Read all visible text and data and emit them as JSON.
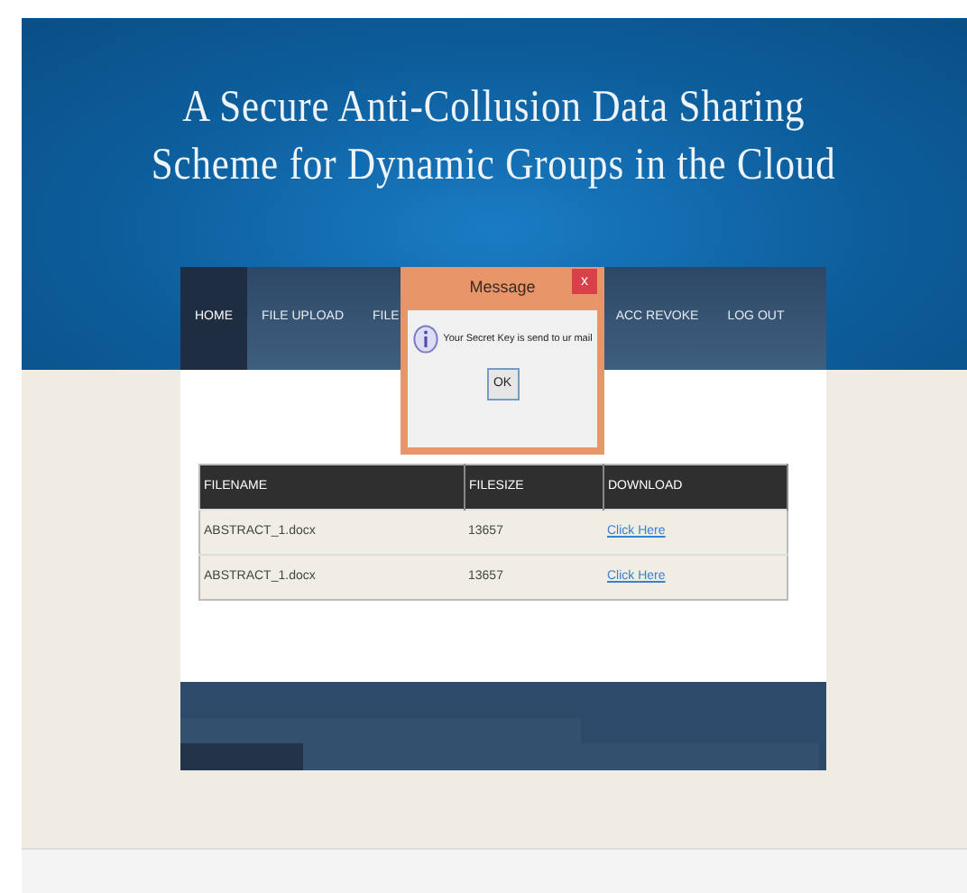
{
  "header": {
    "title_lines": [
      "A Secure Anti-Collusion Data Sharing",
      "Scheme for Dynamic Groups in the Cloud"
    ]
  },
  "nav": [
    {
      "label": "HOME",
      "selected": true
    },
    {
      "label": "FILE UPLOAD",
      "selected": false
    },
    {
      "label": "FILE",
      "selected": false
    },
    {
      "label": "ACC REVOKE",
      "selected": false
    },
    {
      "label": "LOG OUT",
      "selected": false
    }
  ],
  "dialog": {
    "title": "Message",
    "close": "x",
    "message": "Your Secret Key is send to ur mail",
    "button": "OK"
  },
  "table": {
    "columns": [
      "FILENAME",
      "FILESIZE",
      "DOWNLOAD"
    ],
    "rows": [
      {
        "filename": "ABSTRACT_1.docx",
        "filesize": "13657",
        "download": "Click Here"
      },
      {
        "filename": "ABSTRACT_1.docx",
        "filesize": "13657",
        "download": "Click Here"
      }
    ]
  }
}
